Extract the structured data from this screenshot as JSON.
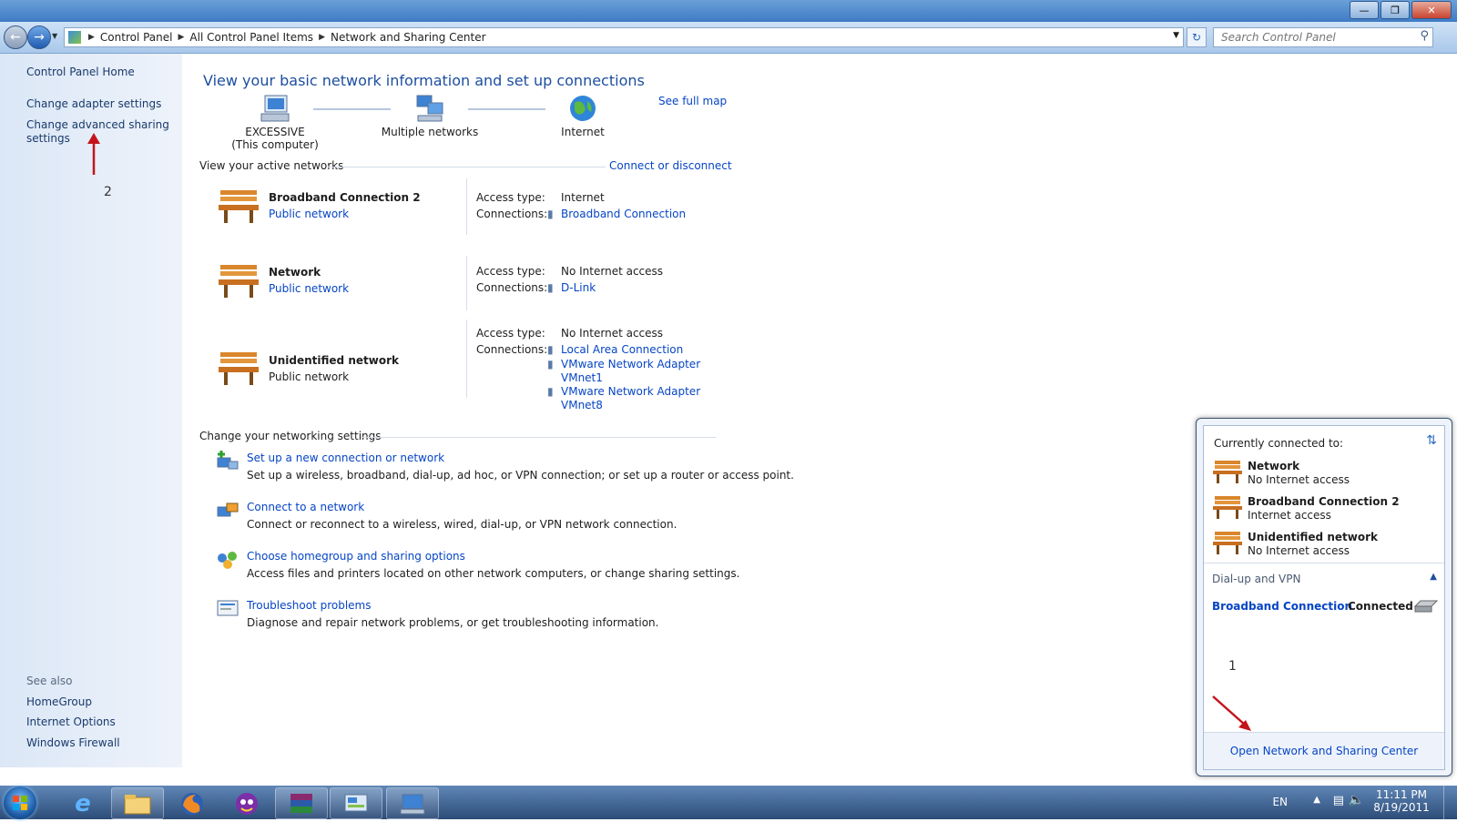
{
  "address": {
    "crumbs": [
      "Control Panel",
      "All Control Panel Items",
      "Network and Sharing Center"
    ],
    "search_placeholder": "Search Control Panel"
  },
  "sidebar": {
    "home": "Control Panel Home",
    "tasks": [
      "Change adapter settings",
      "Change advanced sharing\nsettings"
    ],
    "see_also_title": "See also",
    "see_also": [
      "HomeGroup",
      "Internet Options",
      "Windows Firewall"
    ]
  },
  "main": {
    "title": "View your basic network information and set up connections",
    "see_full_map": "See full map",
    "map": {
      "computer_name": "EXCESSIVE",
      "computer_sub": "(This computer)",
      "middle": "Multiple networks",
      "end": "Internet"
    },
    "active_header": "View your active networks",
    "connect_disconnect": "Connect or disconnect",
    "access_type_label": "Access type:",
    "connections_label": "Connections:",
    "networks": [
      {
        "name": "Broadband Connection  2",
        "type": "Public network",
        "type_link": true,
        "access": "Internet",
        "connections": [
          "Broadband Connection"
        ]
      },
      {
        "name": "Network",
        "type": "Public network",
        "type_link": true,
        "access": "No Internet access",
        "connections": [
          "D-Link"
        ]
      },
      {
        "name": "Unidentified network",
        "type": "Public network",
        "type_link": false,
        "access": "No Internet access",
        "connections": [
          "Local Area Connection",
          "VMware Network Adapter\nVMnet1",
          "VMware Network Adapter\nVMnet8"
        ]
      }
    ],
    "settings_header": "Change your networking settings",
    "tasks": [
      {
        "title": "Set up a new connection or network",
        "desc": "Set up a wireless, broadband, dial-up, ad hoc, or VPN connection; or set up a router or access point."
      },
      {
        "title": "Connect to a network",
        "desc": "Connect or reconnect to a wireless, wired, dial-up, or VPN network connection."
      },
      {
        "title": "Choose homegroup and sharing options",
        "desc": "Access files and printers located on other network computers, or change sharing settings."
      },
      {
        "title": "Troubleshoot problems",
        "desc": "Diagnose and repair network problems, or get troubleshooting information."
      }
    ]
  },
  "popup": {
    "header": "Currently connected to:",
    "networks": [
      {
        "name": "Network",
        "status": "No Internet access"
      },
      {
        "name": "Broadband Connection  2",
        "status": "Internet access"
      },
      {
        "name": "Unidentified network",
        "status": "No Internet access"
      }
    ],
    "dialup_header": "Dial-up and VPN",
    "dialup_name": "Broadband Connection",
    "dialup_status": "Connected",
    "footer": "Open Network and Sharing Center"
  },
  "annotations": {
    "one": "1",
    "two": "2"
  },
  "tray": {
    "lang": "EN",
    "time": "11:11 PM",
    "date": "8/19/2011"
  },
  "colors": {
    "link": "#0645c5",
    "title": "#1d4ea0",
    "arrow": "#c4141b"
  }
}
